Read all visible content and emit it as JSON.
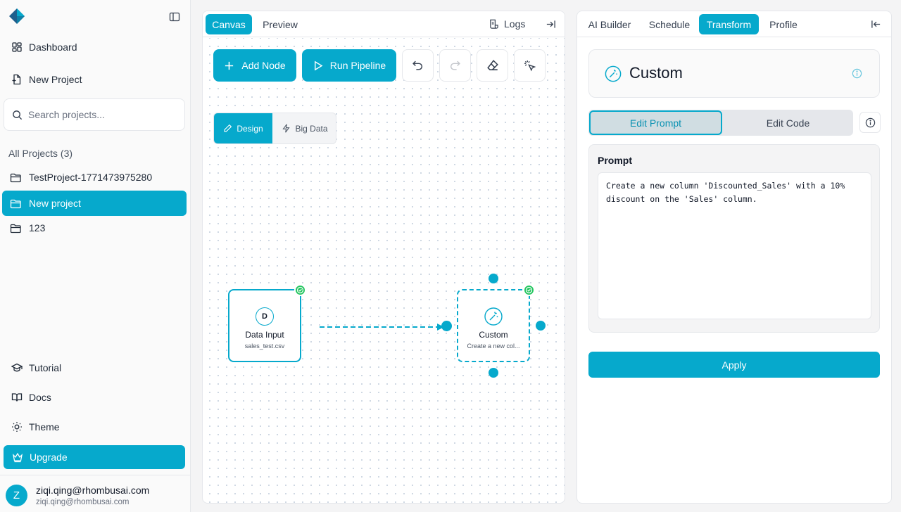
{
  "sidebar": {
    "nav": [
      {
        "label": "Dashboard",
        "icon": "dashboard-icon"
      },
      {
        "label": "New Project",
        "icon": "new-file-icon"
      }
    ],
    "search_placeholder": "Search projects...",
    "projects_heading": "All Projects (3)",
    "projects": [
      {
        "name": "TestProject-1771473975280",
        "active": false
      },
      {
        "name": "New project",
        "active": true
      },
      {
        "name": "123",
        "active": false
      }
    ],
    "bottom": [
      {
        "label": "Tutorial",
        "icon": "graduation-cap-icon"
      },
      {
        "label": "Docs",
        "icon": "book-icon"
      },
      {
        "label": "Theme",
        "icon": "sun-icon"
      }
    ],
    "upgrade_label": "Upgrade",
    "user": {
      "initial": "Z",
      "name": "ziqi.qing@rhombusai.com",
      "email": "ziqi.qing@rhombusai.com"
    }
  },
  "canvas": {
    "tabs": [
      "Canvas",
      "Preview"
    ],
    "active_tab": "Canvas",
    "logs_label": "Logs",
    "toolbar": {
      "add_node": "Add Node",
      "run_pipeline": "Run Pipeline"
    },
    "modes": {
      "design": "Design",
      "big_data": "Big Data",
      "active": "Design"
    },
    "nodes": [
      {
        "id": "data-input",
        "badge": "D",
        "title": "Data Input",
        "subtitle": "sales_test.csv",
        "status": "success"
      },
      {
        "id": "custom",
        "title": "Custom",
        "subtitle": "Create a new col...",
        "status": "success",
        "selected": true
      }
    ]
  },
  "right": {
    "tabs": [
      "AI Builder",
      "Schedule",
      "Transform",
      "Profile"
    ],
    "active_tab": "Transform",
    "header_title": "Custom",
    "edit_prompt": "Edit Prompt",
    "edit_code": "Edit Code",
    "prompt_label": "Prompt",
    "prompt_value": "Create a new column 'Discounted_Sales' with a 10% discount on the 'Sales' column.",
    "apply_label": "Apply"
  },
  "colors": {
    "accent": "#06a9cc",
    "success": "#22c55e",
    "border": "#e5e7eb"
  }
}
